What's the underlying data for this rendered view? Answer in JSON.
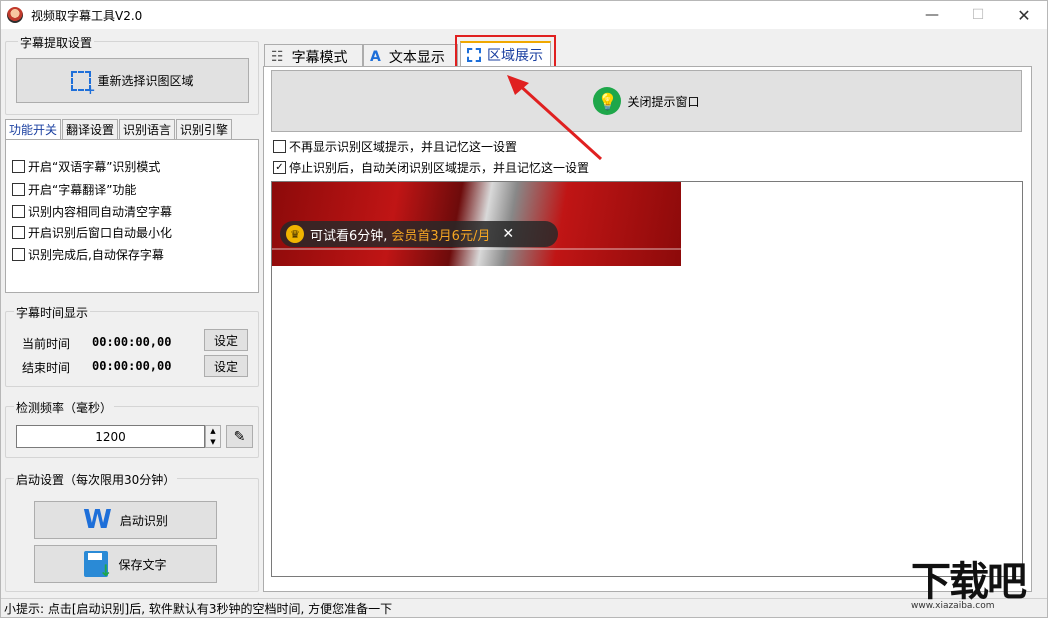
{
  "window": {
    "title": "视频取字幕工具V2.0",
    "min": "—",
    "max": "☐",
    "close": "✕"
  },
  "left": {
    "extract_group": "字幕提取设置",
    "reselect_button": "重新选择识图区域",
    "tabs": [
      {
        "label": "功能开关"
      },
      {
        "label": "翻译设置"
      },
      {
        "label": "识别语言"
      },
      {
        "label": "识别引擎"
      }
    ],
    "options": [
      {
        "label": "开启“双语字幕”识别模式",
        "checked": false
      },
      {
        "label": "开启“字幕翻译”功能",
        "checked": false
      },
      {
        "label": "识别内容相同自动清空字幕",
        "checked": false
      },
      {
        "label": "开启识别后窗口自动最小化",
        "checked": false
      },
      {
        "label": "识别完成后,自动保存字幕",
        "checked": false
      }
    ],
    "time_group": "字幕时间显示",
    "current_label": "当前时间",
    "current_value": "00:00:00,00",
    "current_set": "设定",
    "end_label": "结束时间",
    "end_value": "00:00:00,00",
    "end_set": "设定",
    "freq_group": "检测频率（毫秒）",
    "freq_value": "1200",
    "start_group": "启动设置（每次限用30分钟）",
    "start_button": "启动识别",
    "save_button": "保存文字"
  },
  "right": {
    "tabs": [
      {
        "label": "字幕模式"
      },
      {
        "label": "文本显示"
      },
      {
        "label": "区域展示"
      }
    ],
    "close_hint_button": "关闭提示窗口",
    "opt1": "不再显示识别区域提示，并且记忆这一设置",
    "opt2": "停止识别后，自动关闭识别区域提示，并且记忆这一设置",
    "preview_text": "可试看6分钟,",
    "preview_promo": "会员首3月6元/月",
    "preview_close": "✕"
  },
  "status": "小提示: 点击[启动识别]后, 软件默认有3秒钟的空档时间, 方便您准备一下",
  "watermark": {
    "main": "下载吧",
    "url": "www.xiazaiba.com"
  },
  "colors": {
    "accent": "#1a3fa0",
    "highlight": "#e02020",
    "green": "#1ea74a",
    "promo": "#f5a623"
  }
}
